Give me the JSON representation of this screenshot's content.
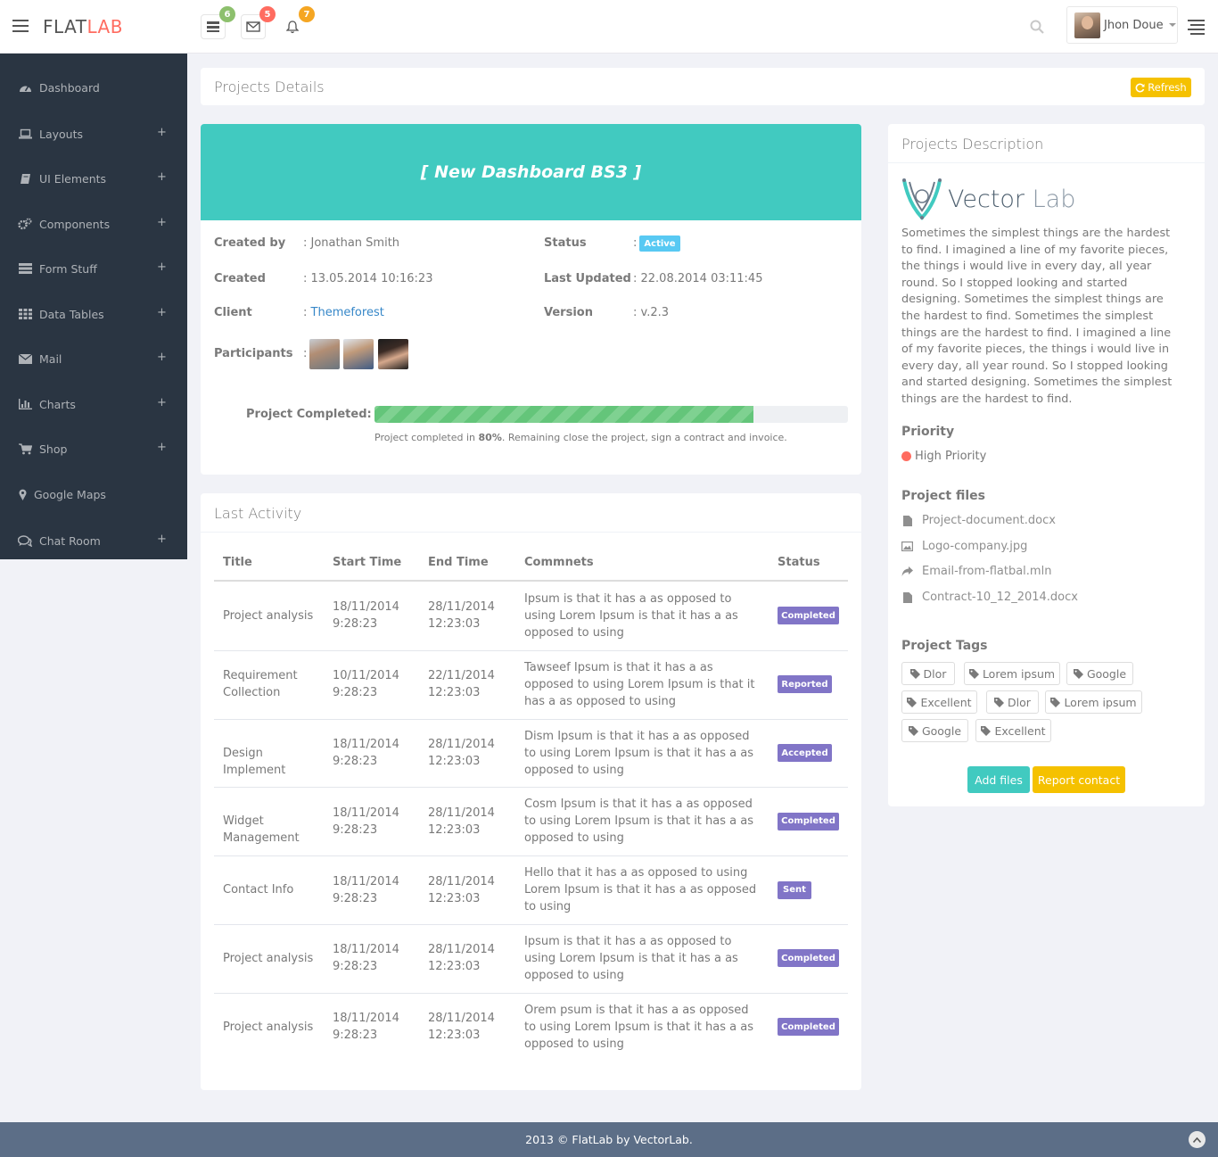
{
  "header": {
    "logo_flat": "FLAT",
    "logo_lab": "LAB",
    "notifications": [
      {
        "icon": "tasks-icon",
        "count": "6",
        "color": "#8dc06d"
      },
      {
        "icon": "envelope-icon",
        "count": "5",
        "color": "#ff6c60"
      },
      {
        "icon": "bell-icon",
        "count": "7",
        "color": "#f5a623"
      }
    ],
    "user_name": "Jhon Doue"
  },
  "sidebar": {
    "items": [
      {
        "label": "Dashboard",
        "icon": "dashboard-icon",
        "plus": ""
      },
      {
        "label": "Layouts",
        "icon": "laptop-icon",
        "plus": "+"
      },
      {
        "label": "UI Elements",
        "icon": "book-icon",
        "plus": "+"
      },
      {
        "label": "Components",
        "icon": "cogs-icon",
        "plus": "+"
      },
      {
        "label": "Form Stuff",
        "icon": "tasks-icon",
        "plus": "+"
      },
      {
        "label": "Data Tables",
        "icon": "th-icon",
        "plus": "+"
      },
      {
        "label": "Mail",
        "icon": "envelope-icon",
        "plus": "+"
      },
      {
        "label": "Charts",
        "icon": "bar-chart-icon",
        "plus": "+"
      },
      {
        "label": "Shop",
        "icon": "shopping-cart-icon",
        "plus": "+"
      },
      {
        "label": "Google Maps",
        "icon": "map-marker-icon",
        "plus": ""
      },
      {
        "label": "Chat Room",
        "icon": "comments-icon",
        "plus": "+"
      }
    ]
  },
  "projects_details": {
    "title": "Projects Details",
    "refresh_label": "Refresh"
  },
  "project": {
    "banner": "[ New Dashboard BS3 ]",
    "created_by_label": "Created by",
    "created_by_value": ": Jonathan Smith",
    "created_label": "Created",
    "created_value": ": 13.05.2014 10:16:23",
    "client_label": "Client",
    "client_colon": ": ",
    "client_value": "Themeforest",
    "participants_label": "Participants",
    "participants_colon": ":",
    "status_label": "Status",
    "status_colon": ":",
    "status_value": "Active",
    "last_updated_label": "Last Updated",
    "last_updated_value": ": 22.08.2014 03:11:45",
    "version_label": "Version",
    "version_value": ": v.2.3",
    "completed_label": "Project Completed:",
    "progress_fraction": 0.8,
    "progress_text_prefix": "Project completed in ",
    "progress_text_pct": "80%",
    "progress_text_suffix": ". Remaining close the project, sign a contract and invoice."
  },
  "activity": {
    "title": "Last Activity",
    "headers": [
      "Title",
      "Start Time",
      "End Time",
      "Commnets",
      "Status"
    ],
    "rows": [
      {
        "title": "Project analysis",
        "start": "18/11/2014\n9:28:23",
        "end": "28/11/2014\n12:23:03",
        "comment": "Ipsum is that it has a as opposed to using Lorem Ipsum is that it has a as opposed to using",
        "status": "Completed"
      },
      {
        "title": "Requirement Collection",
        "start": "10/11/2014\n9:28:23",
        "end": "22/11/2014\n12:23:03",
        "comment": "Tawseef Ipsum is that it has a as opposed to using Lorem Ipsum is that it has a as opposed to using",
        "status": "Reported"
      },
      {
        "title": "Design Implement",
        "start": "18/11/2014\n9:28:23",
        "end": "28/11/2014\n12:23:03",
        "comment": "Dism Ipsum is that it has a as opposed to using Lorem Ipsum is that it has a as opposed to using",
        "status": "Accepted"
      },
      {
        "title": "Widget Management",
        "start": "18/11/2014\n9:28:23",
        "end": "28/11/2014\n12:23:03",
        "comment": "Cosm Ipsum is that it has a as opposed to using Lorem Ipsum is that it has a as opposed to using",
        "status": "Completed"
      },
      {
        "title": "Contact Info",
        "start": "18/11/2014\n9:28:23",
        "end": "28/11/2014\n12:23:03",
        "comment": "Hello that it has a as opposed to using Lorem Ipsum is that it has a as opposed to using",
        "status": "Sent"
      },
      {
        "title": "Project analysis",
        "start": "18/11/2014\n9:28:23",
        "end": "28/11/2014\n12:23:03",
        "comment": "Ipsum is that it has a as opposed to using Lorem Ipsum is that it has a as opposed to using",
        "status": "Completed"
      },
      {
        "title": "Project analysis",
        "start": "18/11/2014\n9:28:23",
        "end": "28/11/2014\n12:23:03",
        "comment": "Orem psum is that it has a as opposed to using Lorem Ipsum is that it has a as opposed to using",
        "status": "Completed"
      }
    ]
  },
  "description": {
    "title": "Projects Description",
    "brand_vector": "Vector",
    "brand_lab": " Lab",
    "text": "Sometimes the simplest things are the hardest to find. I imagined a line of my favorite pieces, the things i would live in every day, all year round. So I stopped looking and started designing. Sometimes the simplest things are the hardest to find. Sometimes the simplest things are the hardest to find. I imagined a line of my favorite pieces, the things i would live in every day, all year round. So I stopped looking and started designing. Sometimes the simplest things are the hardest to find.",
    "priority_heading": "Priority",
    "priority_value": "High Priority",
    "priority_color": "#ff6c60",
    "files_heading": "Project files",
    "files": [
      {
        "name": "Project-document.docx",
        "icon": "file-icon"
      },
      {
        "name": "Logo-company.jpg",
        "icon": "picture-icon"
      },
      {
        "name": "Email-from-flatbal.mln",
        "icon": "share-icon"
      },
      {
        "name": "Contract-10_12_2014.docx",
        "icon": "file-icon"
      }
    ],
    "tags_heading": "Project Tags",
    "tags": [
      "Dlor",
      "Lorem ipsum",
      "Google",
      "Excellent",
      "Dlor",
      "Lorem ipsum",
      "Google",
      "Excellent"
    ],
    "add_files_label": "Add files",
    "report_contact_label": "Report contact"
  },
  "footer": {
    "text": "2013 © FlatLab by VectorLab."
  }
}
